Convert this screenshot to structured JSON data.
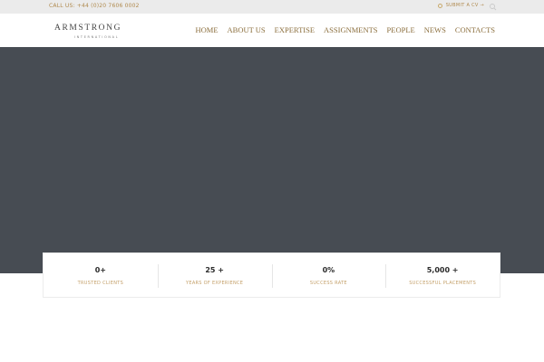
{
  "topbar": {
    "call_text": "CALL US: +44 (0)20 7606 0002",
    "submit_cv": "SUBMIT A CV →",
    "submit_icon": "map-pin-icon",
    "search_icon": "search-icon"
  },
  "header": {
    "logo_main": "ARMSTRONG",
    "logo_sub": "INTERNATIONAL",
    "nav": [
      "HOME",
      "ABOUT US",
      "EXPERTISE",
      "ASSIGNMENTS",
      "PEOPLE",
      "NEWS",
      "CONTACTS"
    ]
  },
  "colors": {
    "accent": "#b08a4e",
    "hero_bg": "#474c53",
    "topbar_bg": "#ebebeb"
  },
  "stats": [
    {
      "value": "0+",
      "label": "TRUSTED CLIENTS"
    },
    {
      "value": "25 +",
      "label": "YEARS OF EXPERIENCE"
    },
    {
      "value": "0%",
      "label": "SUCCESS RATE"
    },
    {
      "value": "5,000 +",
      "label": "SUCCESSFUL PLACEMENTS"
    }
  ]
}
